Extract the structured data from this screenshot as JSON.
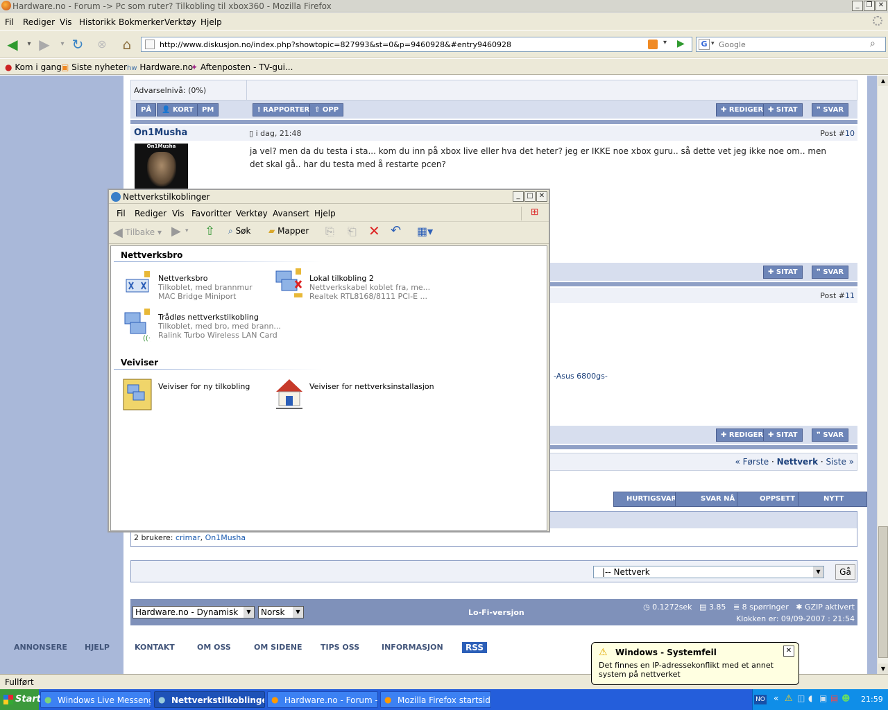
{
  "firefox": {
    "title": "Hardware.no - Forum -> Pc som ruter? Tilkobling til xbox360 - Mozilla Firefox",
    "menu": [
      "Fil",
      "Rediger",
      "Vis",
      "Historikk",
      "Bokmerker",
      "Verktøy",
      "Hjelp"
    ],
    "url": "http://www.diskusjon.no/index.php?showtopic=827993&st=0&p=9460928&#entry9460928",
    "search_placeholder": "Google",
    "bookmarks": [
      "Kom i gang",
      "Siste nyheter",
      "Hardware.no",
      "Aftenposten - TV-gui..."
    ],
    "status": "Fullført"
  },
  "forum": {
    "warning_level": "Advarselnivå: (0%)",
    "post_buttons_left": [
      "PÅ",
      "KORT",
      "PM"
    ],
    "post_buttons_mid": [
      "RAPPORTER",
      "OPP"
    ],
    "post_buttons_right": [
      "REDIGER",
      "SITAT",
      "SVAR"
    ],
    "post10": {
      "author": "On1Musha",
      "avatar_text": "On1Musha",
      "date": "i dag, 21:48",
      "post_label": "Post #",
      "post_number": "10",
      "body_line1": "ja vel? men da du testa i sta... kom du inn på xbox live eller hva det heter? jeg er IKKE noe xbox guru.. så dette vet jeg ikke noe om.. men",
      "body_line2": "det skal gå.. har du testa med å restarte pcen?"
    },
    "post10_buttons": [
      "SITAT",
      "SVAR"
    ],
    "post11": {
      "post_label": "Post #",
      "post_number": "11",
      "signature": "-Asus 6800gs-"
    },
    "post11_buttons": [
      "REDIGER",
      "SITAT",
      "SVAR"
    ],
    "pagination": {
      "first": "« Første",
      "current": "Nettverk",
      "last": "Siste »"
    },
    "action_buttons": [
      "HURTIGSVAR",
      "SVAR NÅ",
      "OPPSETT",
      "NYTT EMNE"
    ],
    "users_prefix": "2 brukere: ",
    "users": [
      "crimar",
      "On1Musha"
    ],
    "jump_select": "|-- Nettverk",
    "jump_button": "Gå",
    "skin_select": "Hardware.no - Dynamisk",
    "lang_select": "Norsk",
    "lofi": "Lo-Fi-versjon",
    "stats": {
      "time": "0.1272sek",
      "load": "3.85",
      "queries": "8 spørringer",
      "gzip": "GZIP aktivert",
      "clock": "Klokken er: 09/09-2007 : 21:54"
    },
    "footer_links": [
      "ANNONSERE",
      "HJELP",
      "KONTAKT",
      "OM OSS",
      "OM SIDENE",
      "TIPS OSS",
      "INFORMASJON",
      "RSS"
    ]
  },
  "explorer": {
    "title": "Nettverkstilkoblinger",
    "menu": [
      "Fil",
      "Rediger",
      "Vis",
      "Favoritter",
      "Verktøy",
      "Avansert",
      "Hjelp"
    ],
    "toolbar": {
      "back": "Tilbake",
      "search": "Søk",
      "folders": "Mapper"
    },
    "group1": "Nettverksbro",
    "items": [
      {
        "name": "Nettverksbro",
        "line1": "Tilkoblet, med brannmur",
        "line2": "MAC Bridge Miniport"
      },
      {
        "name": "Lokal tilkobling 2",
        "line1": "Nettverkskabel koblet fra, me...",
        "line2": "Realtek RTL8168/8111 PCI-E ..."
      },
      {
        "name": "Trådløs nettverkstilkobling",
        "line1": "Tilkoblet, med bro, med brann...",
        "line2": "Ralink Turbo Wireless LAN Card"
      }
    ],
    "group2": "Veiviser",
    "wizards": [
      "Veiviser for ny tilkobling",
      "Veiviser for nettverksinstallasjon"
    ]
  },
  "balloon": {
    "title": "Windows - Systemfeil",
    "text": "Det finnes en IP-adressekonflikt med et annet system på nettverket"
  },
  "taskbar": {
    "start": "Start",
    "buttons": [
      "Windows Live Messenger",
      "Nettverkstilkoblinger",
      "Hardware.no - Forum ->...",
      "Mozilla Firefox startside -..."
    ],
    "lang": "NO",
    "clock": "21:59"
  }
}
